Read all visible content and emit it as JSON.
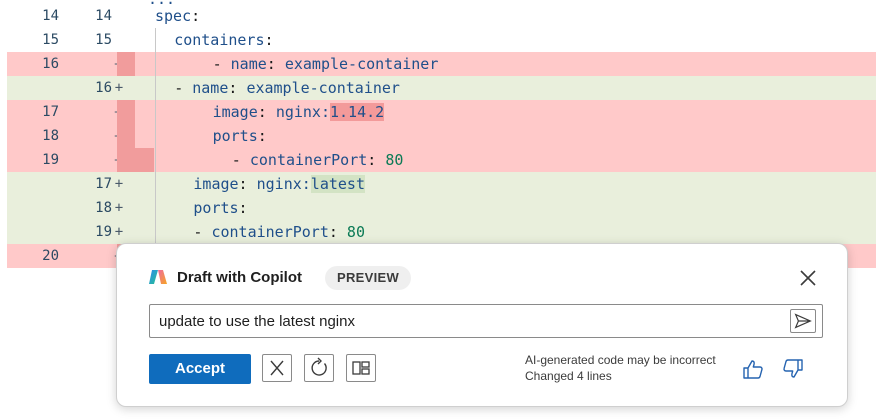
{
  "diff": {
    "top_partial": "...",
    "lines": [
      {
        "type": "ctx",
        "old": "14",
        "new": "14",
        "sign": "",
        "indent": "",
        "tokens": [
          {
            "t": "spec",
            "c": "k"
          },
          {
            "t": ":",
            "c": "p"
          }
        ]
      },
      {
        "type": "ctx",
        "old": "15",
        "new": "15",
        "sign": "",
        "indent": "  ",
        "tokens": [
          {
            "t": "containers",
            "c": "k"
          },
          {
            "t": ":",
            "c": "p"
          }
        ]
      },
      {
        "type": "del",
        "old": "16",
        "new": "",
        "sign": "—",
        "indent": "      ",
        "tokens": [
          {
            "t": "- ",
            "c": "p"
          },
          {
            "t": "name",
            "c": "k"
          },
          {
            "t": ": ",
            "c": "p"
          },
          {
            "t": "example-container",
            "c": "s"
          }
        ]
      },
      {
        "type": "add",
        "old": "",
        "new": "16",
        "sign": "+",
        "indent": "  ",
        "tokens": [
          {
            "t": "- ",
            "c": "p"
          },
          {
            "t": "name",
            "c": "k"
          },
          {
            "t": ": ",
            "c": "p"
          },
          {
            "t": "example-container",
            "c": "s"
          }
        ]
      },
      {
        "type": "del",
        "old": "17",
        "new": "",
        "sign": "—",
        "indent": "      ",
        "tokens": [
          {
            "t": "image",
            "c": "k"
          },
          {
            "t": ": ",
            "c": "p"
          },
          {
            "t": "nginx:",
            "c": "s"
          },
          {
            "t": "1.14.2",
            "c": "s",
            "hl": "del"
          }
        ]
      },
      {
        "type": "del",
        "old": "18",
        "new": "",
        "sign": "—",
        "indent": "      ",
        "tokens": [
          {
            "t": "ports",
            "c": "k"
          },
          {
            "t": ":",
            "c": "p"
          }
        ]
      },
      {
        "type": "del",
        "old": "19",
        "new": "",
        "sign": "—",
        "indent": "        ",
        "tokens": [
          {
            "t": "- ",
            "c": "p"
          },
          {
            "t": "containerPort",
            "c": "k"
          },
          {
            "t": ": ",
            "c": "p"
          },
          {
            "t": "80",
            "c": "n"
          }
        ]
      },
      {
        "type": "add",
        "old": "",
        "new": "17",
        "sign": "+",
        "indent": "    ",
        "tokens": [
          {
            "t": "image",
            "c": "k"
          },
          {
            "t": ": ",
            "c": "p"
          },
          {
            "t": "nginx:",
            "c": "s"
          },
          {
            "t": "latest",
            "c": "s",
            "hl": "add"
          }
        ]
      },
      {
        "type": "add",
        "old": "",
        "new": "18",
        "sign": "+",
        "indent": "    ",
        "tokens": [
          {
            "t": "ports",
            "c": "k"
          },
          {
            "t": ":",
            "c": "p"
          }
        ]
      },
      {
        "type": "add",
        "old": "",
        "new": "19",
        "sign": "+",
        "indent": "    ",
        "tokens": [
          {
            "t": "- ",
            "c": "p"
          },
          {
            "t": "containerPort",
            "c": "k"
          },
          {
            "t": ": ",
            "c": "p"
          },
          {
            "t": "80",
            "c": "n"
          }
        ]
      },
      {
        "type": "del",
        "old": "20",
        "new": "",
        "sign": "—",
        "indent": "",
        "tokens": []
      }
    ]
  },
  "copilot": {
    "title": "Draft with Copilot",
    "badge": "PREVIEW",
    "prompt_value": "update to use the latest nginx",
    "accept_label": "Accept",
    "note_line1": "AI-generated code may be incorrect",
    "note_line2": "Changed 4 lines",
    "icons": {
      "close": "close-icon",
      "send": "send-icon",
      "discard": "discard-icon",
      "regenerate": "regenerate-icon",
      "toggle": "toggle-diff-view-icon",
      "like": "thumbs-up-icon",
      "dislike": "thumbs-down-icon",
      "logo": "copilot-logo-icon"
    }
  },
  "colors": {
    "accent": "#0f6cbd",
    "deleted_bg": "#ffc9c9",
    "added_bg": "#e9efdc"
  }
}
